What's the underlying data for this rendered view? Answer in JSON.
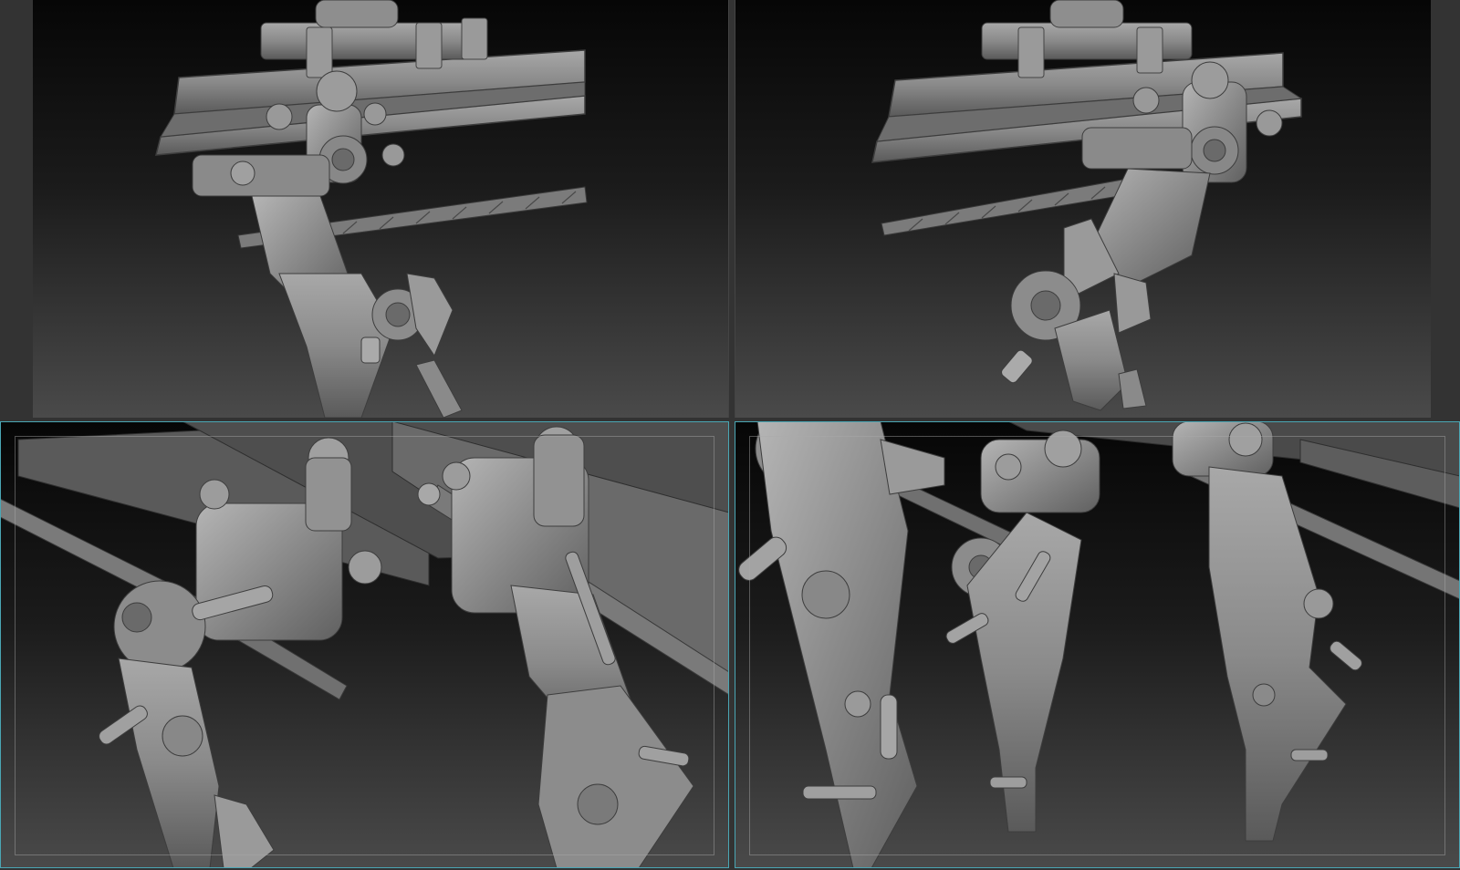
{
  "sheet": {
    "description_free": true
  },
  "viewports": [
    {
      "id": "top-left",
      "active": false
    },
    {
      "id": "top-right",
      "active": false
    },
    {
      "id": "bottom-left",
      "active": true
    },
    {
      "id": "bottom-right",
      "active": true
    }
  ],
  "colors": {
    "background": "#333333",
    "viewport_top": "#060606",
    "viewport_bottom": "#4a4a4a",
    "clay": "#8c8c8c",
    "clay_light": "#b3b3b3",
    "clay_dark": "#5b5b5b",
    "active_frame": "#4aa6b4"
  }
}
